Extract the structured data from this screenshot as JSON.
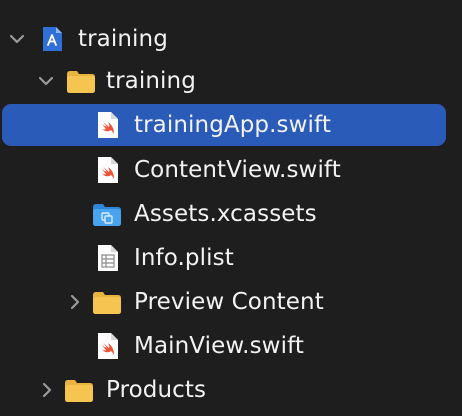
{
  "navigator": {
    "project": {
      "label": "training",
      "icon": "xcode-project-icon",
      "expanded": true
    },
    "group": {
      "label": "training",
      "icon": "folder-icon",
      "expanded": true
    },
    "files": [
      {
        "label": "trainingApp.swift",
        "icon": "swift-file-icon",
        "selected": true
      },
      {
        "label": "ContentView.swift",
        "icon": "swift-file-icon",
        "selected": false
      },
      {
        "label": "Assets.xcassets",
        "icon": "asset-catalog-icon",
        "selected": false
      },
      {
        "label": "Info.plist",
        "icon": "plist-file-icon",
        "selected": false
      },
      {
        "label": "Preview Content",
        "icon": "folder-icon",
        "expanded": false
      },
      {
        "label": "MainView.swift",
        "icon": "swift-file-icon",
        "selected": false
      }
    ],
    "products": {
      "label": "Products",
      "icon": "folder-icon",
      "expanded": false
    }
  },
  "colors": {
    "background": "#1e1e1e",
    "selection": "#2a5bb8",
    "folder": "#f5c451",
    "swift": "#f05138",
    "text": "#f2f2f2",
    "chevron": "#9a9a9a"
  }
}
